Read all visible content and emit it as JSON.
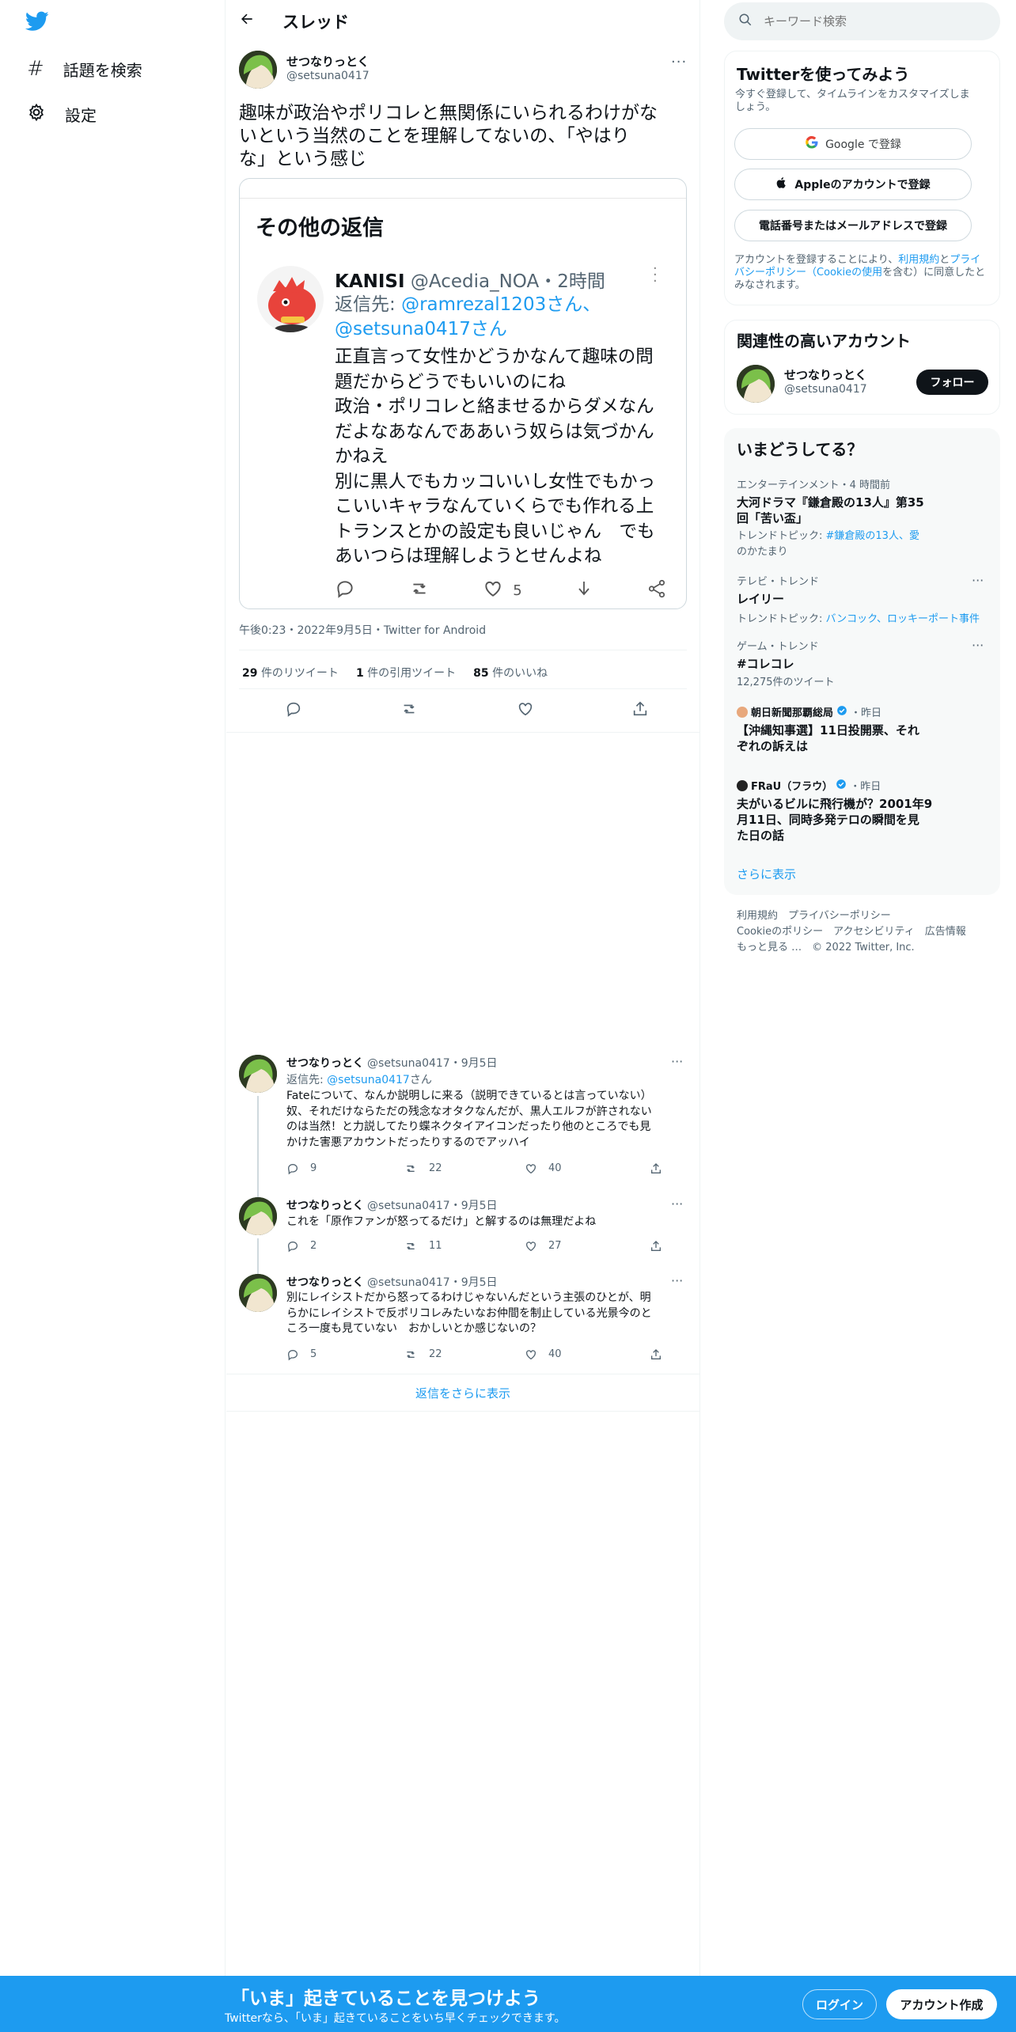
{
  "nav": {
    "explore": "話題を検索",
    "settings": "設定"
  },
  "header": {
    "title": "スレッド"
  },
  "main_tweet": {
    "name": "せつなりっとく",
    "handle": "@setsuna0417",
    "text_lines": [
      "趣味が政治やポリコレと無関係にいられるわけがな",
      "いという当然のことを理解してないの、「やはり",
      "な」という感じ"
    ],
    "timestamp": "午後0:23・2022年9月5日・Twitter for Android",
    "retweets": "29",
    "retweets_label": "件のリツイート",
    "quotes": "1",
    "quotes_label": "件の引用ツイート",
    "likes": "85",
    "likes_label": "件のいいね"
  },
  "embed": {
    "heading": "その他の返信",
    "name": "KANISI",
    "meta": "@Acedia_NOA・2時間",
    "reply_prefix": "返信先: ",
    "reply_to1": "@ramrezal1203さん、",
    "reply_to2": "@setsuna0417さん",
    "lines": [
      "正直言って女性かどうかなんて趣味の問",
      "題だからどうでもいいのにね",
      "政治・ポリコレと絡ませるからダメなん",
      "だよなあなんでああいう奴らは気づかん",
      "かねえ",
      "別に黒人でもカッコいいし女性でもかっ",
      "こいいキャラなんていくらでも作れる上",
      "トランスとかの設定も良いじゃん　でも",
      "あいつらは理解しようとせんよね"
    ],
    "like_count": "5"
  },
  "replies": [
    {
      "name": "せつなりっとく",
      "handle": "@setsuna0417・9月5日",
      "reply_label": "返信先: ",
      "reply_to": "@setsuna0417",
      "reply_suffix": "さん",
      "lines": [
        "Fateについて、なんか説明しに来る（説明できているとは言っていない）",
        "奴、それだけならただの残念なオタクなんだが、黒人エルフが許されない",
        "のは当然！と力説してたり蝶ネクタイアイコンだったり他のところでも見",
        "かけた害悪アカウントだったりするのでアッハイ"
      ],
      "reply_count": "9",
      "rt_count": "22",
      "like_count": "40"
    },
    {
      "name": "せつなりっとく",
      "handle": "@setsuna0417・9月5日",
      "lines": [
        "これを「原作ファンが怒ってるだけ」と解するのは無理だよね"
      ],
      "reply_count": "2",
      "rt_count": "11",
      "like_count": "27"
    },
    {
      "name": "せつなりっとく",
      "handle": "@setsuna0417・9月5日",
      "lines": [
        "別にレイシストだから怒ってるわけじゃないんだという主張のひとが、明",
        "らかにレイシストで反ポリコレみたいなお仲間を制止している光景今のと",
        "ころ一度も見ていない　おかしいとか感じないの？"
      ],
      "reply_count": "5",
      "rt_count": "22",
      "like_count": "40"
    }
  ],
  "show_more": "返信をさらに表示",
  "search": {
    "placeholder": "キーワード検索"
  },
  "signup": {
    "title": "Twitterを使ってみよう",
    "subtitle": "今すぐ登録して、タイムラインをカスタマイズしま",
    "subtitle2": "しょう。",
    "google": "Google で登録",
    "apple": "Appleのアカウントで登録",
    "phone": "電話番号またはメールアドレスで登録",
    "legal1": "アカウントを登録することにより、",
    "terms": "利用規約",
    "and": "と",
    "privacy": "プライ",
    "legal2a": "バシーポリシー",
    "legal2b": "（",
    "cookie": "Cookieの使用",
    "legal2c": "を含む）に同意したと",
    "legal3": "みなされます。"
  },
  "relevant": {
    "title": "関連性の高いアカウント",
    "name": "せつなりっとく",
    "handle": "@setsuna0417",
    "follow": "フォロー"
  },
  "trends": {
    "title": "いまどうしてる？",
    "items": [
      {
        "cat": "エンターテインメント・4 時間前",
        "name1": "大河ドラマ『鎌倉殿の13人』第35",
        "name2": "回「苦い盃」",
        "topic_label": "トレンドトピック: ",
        "topic1": "#鎌倉殿の13人、愛",
        "topic2": "のかたまり"
      },
      {
        "cat": "テレビ・トレンド",
        "name1": "レイリー",
        "topic_label": "トレンドトピック: ",
        "topic1": "バンコック、ロッキーポート事件"
      },
      {
        "cat": "ゲーム・トレンド",
        "name1": "#コレコレ",
        "count": "12,275件のツイート"
      }
    ],
    "news": [
      {
        "source": "朝日新聞那覇総局",
        "time": "・昨日",
        "line1": "【沖縄知事選】11日投開票、それ",
        "line2": "ぞれの訴えは"
      },
      {
        "source": "FRaU（フラウ）",
        "time": "・昨日",
        "line1": "夫がいるビルに飛行機が？2001年9",
        "line2": "月11日、同時多発テロの瞬間を見",
        "line3": "た日の話"
      }
    ],
    "more": "さらに表示"
  },
  "footer": {
    "l1a": "利用規約",
    "l1b": "プライバシーポリシー",
    "l2a": "Cookieのポリシー",
    "l2b": "アクセシビリティ",
    "l2c": "広告情報",
    "l3a": "もっと見る …",
    "l3b": "© 2022 Twitter, Inc."
  },
  "bottom": {
    "title": "「いま」起きていることを見つけよう",
    "subtitle": "Twitterなら、「いま」起きていることをいち早くチェックできます。",
    "login": "ログイン",
    "signup": "アカウント作成"
  },
  "colors": {
    "accent": "#1d9bf0",
    "text": "#0f1419",
    "muted": "#536471"
  }
}
